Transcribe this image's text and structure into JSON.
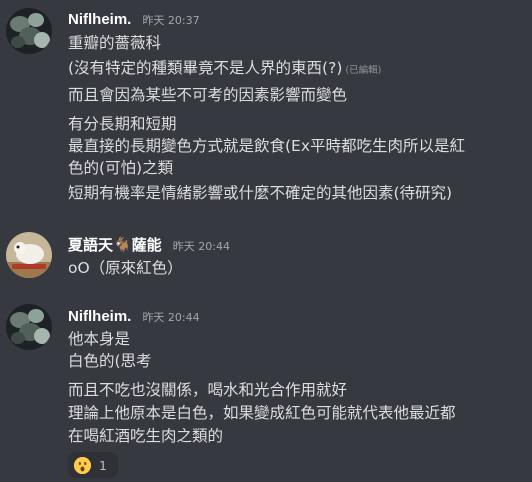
{
  "messages": [
    {
      "username": "Niflheim.",
      "timestamp": "昨天 20:37",
      "lines": [
        "重瓣的薔薇科",
        "(沒有特定的種類畢竟不是人界的東西(?)",
        "而且會因為某些不可考的因素影響而變色",
        "有分長期和短期",
        "最直接的長期變色方式就是飲食(Ex平時都吃生肉所以是紅",
        "色的(可怕)之類",
        "短期有機率是情緒影響或什麼不確定的其他因素(待研究)"
      ],
      "edited_label": "(已編輯)"
    },
    {
      "username": "夏語天🐐薩能",
      "timestamp": "昨天 20:44",
      "lines": [
        "oO（原來紅色）"
      ]
    },
    {
      "username": "Niflheim.",
      "timestamp": "昨天 20:44",
      "lines": [
        "他本身是",
        "白色的(思考",
        "而且不吃也沒關係，喝水和光合作用就好",
        "理論上他原本是白色，如果變成紅色可能就代表他最近都",
        "在喝紅酒吃生肉之類的"
      ],
      "reaction": {
        "emoji": "hushed-face-emoji",
        "count": "1"
      }
    }
  ],
  "colors": {
    "background": "#36393f",
    "username": "#ffffff",
    "text": "#dcddde",
    "timestamp": "#a3a6aa",
    "reaction_bg": "#2f3136"
  }
}
